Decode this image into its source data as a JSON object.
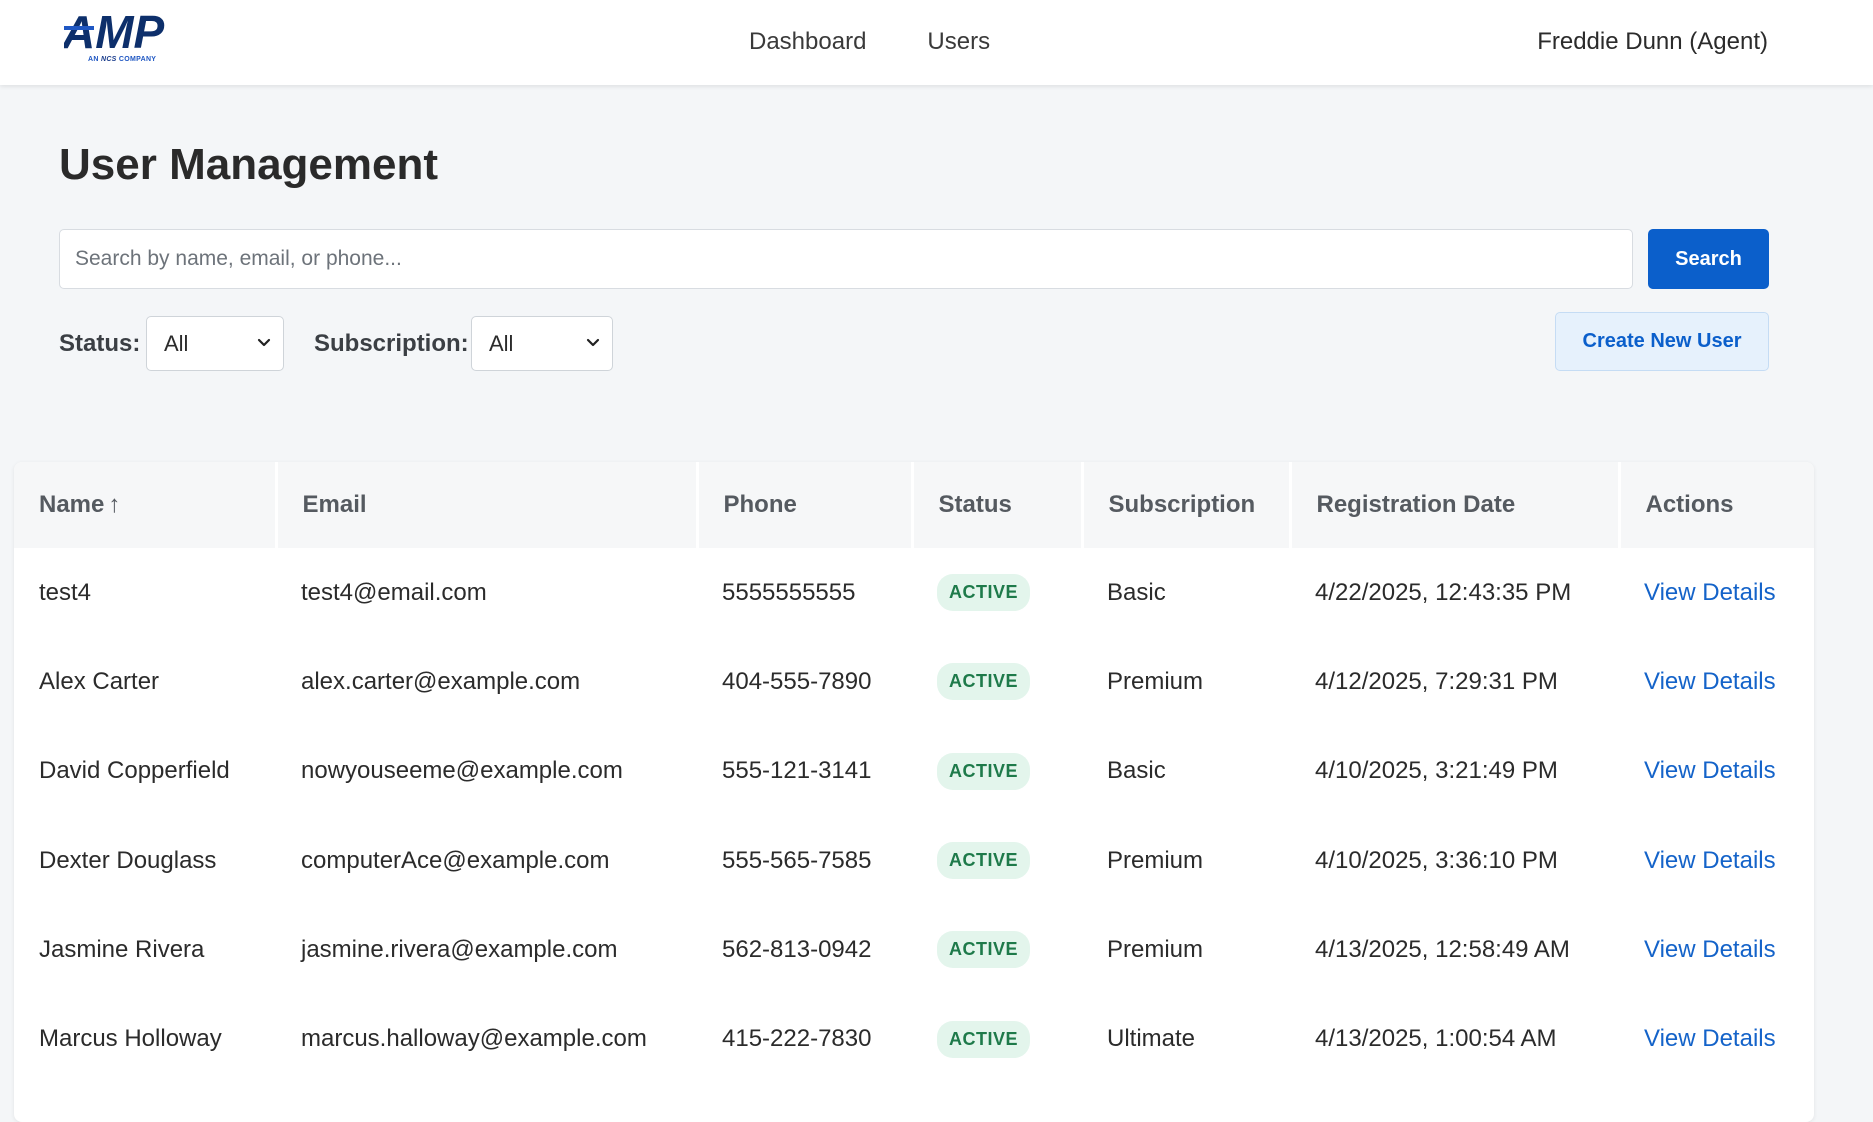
{
  "brand": {
    "logo_text": "AMP",
    "logo_sub_prefix": "AN",
    "logo_sub_mid": "NCS",
    "logo_sub_suffix": "COMPANY",
    "colors": {
      "logo": "#0d2f6b",
      "accent": "#0b5fcb"
    }
  },
  "nav": {
    "items": [
      {
        "label": "Dashboard"
      },
      {
        "label": "Users"
      }
    ],
    "user": "Freddie Dunn (Agent)"
  },
  "page": {
    "title": "User Management"
  },
  "search": {
    "placeholder": "Search by name, email, or phone...",
    "value": "",
    "button_label": "Search"
  },
  "filters": {
    "status_label": "Status:",
    "status_value": "All",
    "subscription_label": "Subscription:",
    "subscription_value": "All"
  },
  "actions": {
    "create_label": "Create New User"
  },
  "table": {
    "headers": {
      "name": "Name",
      "name_sort": "↑",
      "email": "Email",
      "phone": "Phone",
      "status": "Status",
      "subscription": "Subscription",
      "registration": "Registration Date",
      "actions": "Actions"
    },
    "rows": [
      {
        "name": "test4",
        "email": "test4@email.com",
        "phone": "5555555555",
        "status": "ACTIVE",
        "subscription": "Basic",
        "registered": "4/22/2025, 12:43:35 PM",
        "action": "View Details"
      },
      {
        "name": "Alex Carter",
        "email": "alex.carter@example.com",
        "phone": "404-555-7890",
        "status": "ACTIVE",
        "subscription": "Premium",
        "registered": "4/12/2025, 7:29:31 PM",
        "action": "View Details"
      },
      {
        "name": "David Copperfield",
        "email": "nowyouseeme@example.com",
        "phone": "555-121-3141",
        "status": "ACTIVE",
        "subscription": "Basic",
        "registered": "4/10/2025, 3:21:49 PM",
        "action": "View Details"
      },
      {
        "name": "Dexter Douglass",
        "email": "computerAce@example.com",
        "phone": "555-565-7585",
        "status": "ACTIVE",
        "subscription": "Premium",
        "registered": "4/10/2025, 3:36:10 PM",
        "action": "View Details"
      },
      {
        "name": "Jasmine Rivera",
        "email": "jasmine.rivera@example.com",
        "phone": "562-813-0942",
        "status": "ACTIVE",
        "subscription": "Premium",
        "registered": "4/13/2025, 12:58:49 AM",
        "action": "View Details"
      },
      {
        "name": "Marcus Holloway",
        "email": "marcus.halloway@example.com",
        "phone": "415-222-7830",
        "status": "ACTIVE",
        "subscription": "Ultimate",
        "registered": "4/13/2025, 1:00:54 AM",
        "action": "View Details"
      }
    ]
  }
}
